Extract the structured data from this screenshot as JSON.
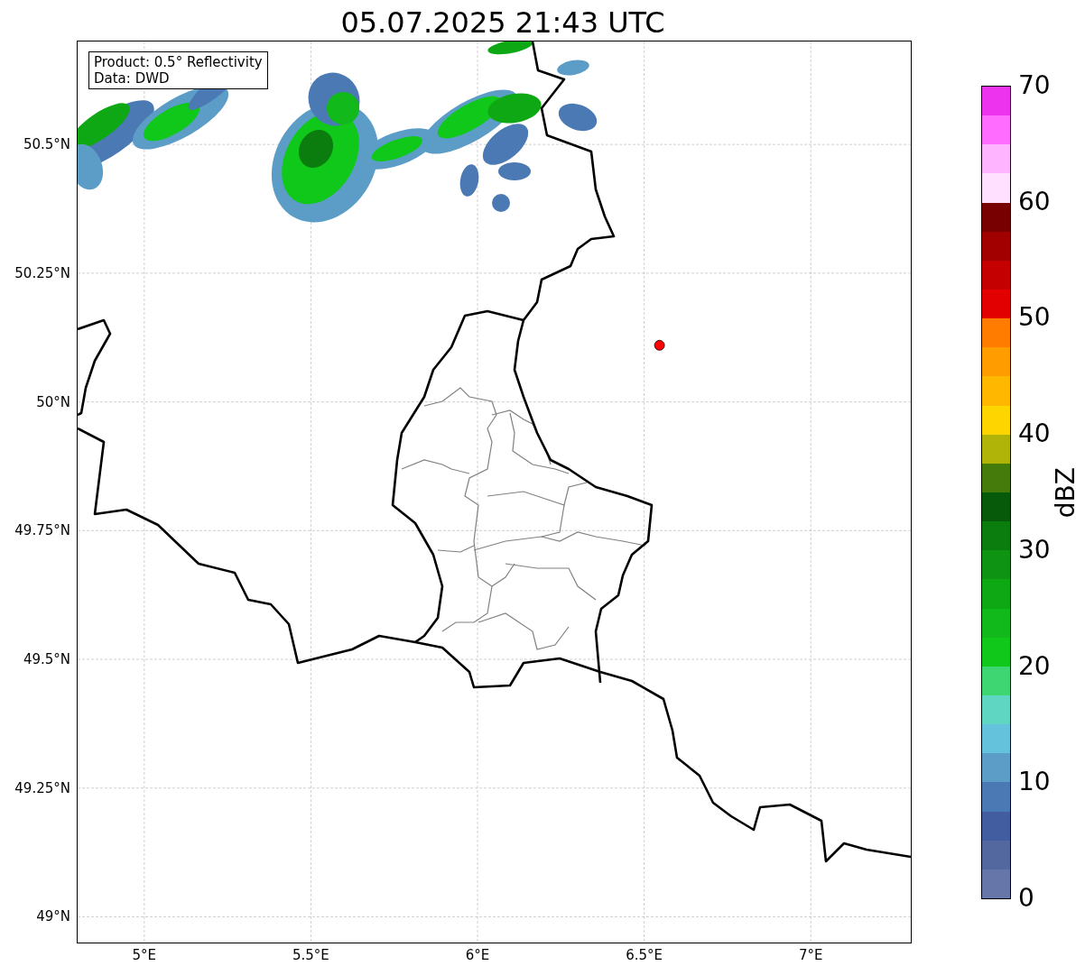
{
  "title": "05.07.2025 21:43 UTC",
  "info_box": {
    "lines": [
      "Product: 0.5° Reflectivity",
      "Data: DWD"
    ]
  },
  "map": {
    "xticks": [
      "5°E",
      "5.5°E",
      "6°E",
      "6.5°E",
      "7°E"
    ],
    "yticks": [
      "50.5°N",
      "50.25°N",
      "50°N",
      "49.75°N",
      "49.5°N",
      "49.25°N",
      "49°N"
    ],
    "marker": {
      "color": "#ff0000"
    }
  },
  "colorbar": {
    "label": "dBZ",
    "ticks": [
      "70",
      "60",
      "50",
      "40",
      "30",
      "20",
      "10",
      "0"
    ],
    "bands": [
      {
        "color": "#ee33ee"
      },
      {
        "color": "#ff6cff"
      },
      {
        "color": "#ffb4ff"
      },
      {
        "color": "#ffe0ff"
      },
      {
        "color": "#780000"
      },
      {
        "color": "#a20000"
      },
      {
        "color": "#c40000"
      },
      {
        "color": "#e20000"
      },
      {
        "color": "#ff7c00"
      },
      {
        "color": "#ff9d00"
      },
      {
        "color": "#ffb700"
      },
      {
        "color": "#ffd500"
      },
      {
        "color": "#b0b408"
      },
      {
        "color": "#457b0a"
      },
      {
        "color": "#075a0a"
      },
      {
        "color": "#0b7d0e"
      },
      {
        "color": "#0e9312"
      },
      {
        "color": "#0fa815"
      },
      {
        "color": "#12b91a"
      },
      {
        "color": "#10c81a"
      },
      {
        "color": "#3dd672"
      },
      {
        "color": "#5ed6c1"
      },
      {
        "color": "#65c2dc"
      },
      {
        "color": "#5b9dc6"
      },
      {
        "color": "#4a79b3"
      },
      {
        "color": "#425da0"
      },
      {
        "color": "#5468a0"
      },
      {
        "color": "#6776a8"
      }
    ]
  }
}
